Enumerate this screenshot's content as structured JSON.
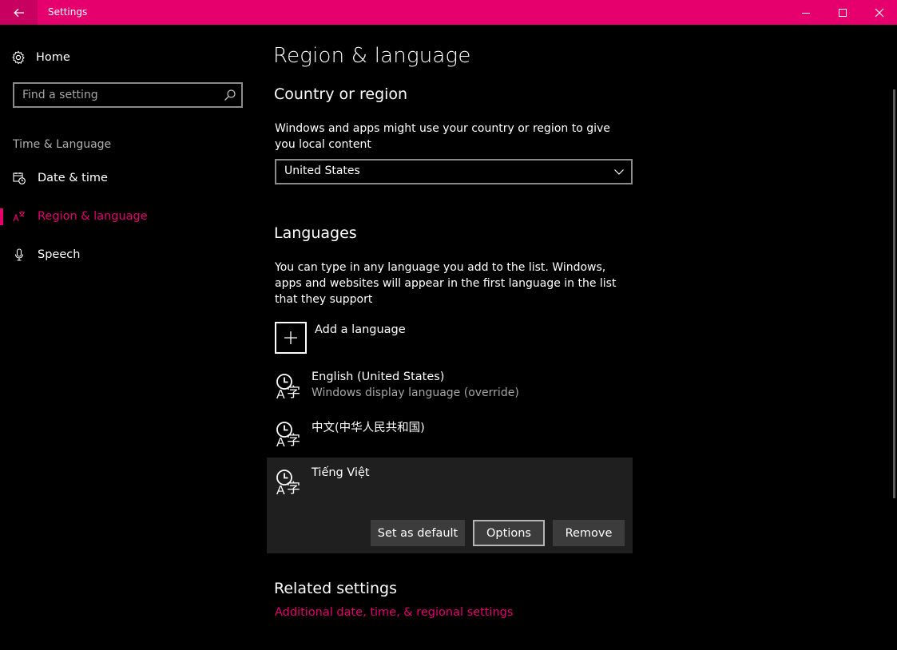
{
  "window": {
    "title": "Settings",
    "accent_color": "#e6006e",
    "buttons": [
      "back-icon",
      "minimize-icon",
      "maximize-icon",
      "close-icon"
    ]
  },
  "sidebar": {
    "home_label": "Home",
    "search_placeholder": "Find a setting",
    "group_label": "Time & Language",
    "items": [
      {
        "label": "Date & time",
        "icon": "date-time-icon",
        "selected": false
      },
      {
        "label": "Region & language",
        "icon": "region-language-icon",
        "selected": true
      },
      {
        "label": "Speech",
        "icon": "microphone-icon",
        "selected": false
      }
    ]
  },
  "main": {
    "title": "Region & language",
    "country": {
      "heading": "Country or region",
      "description": "Windows and apps might use your country or region to give you local content",
      "selected": "United States"
    },
    "languages": {
      "heading": "Languages",
      "description": "You can type in any language you add to the list. Windows, apps and websites will appear in the first language in the list that they support",
      "add_label": "Add a language",
      "items": [
        {
          "name": "English (United States)",
          "sub": "Windows display language (override)"
        },
        {
          "name": "中文(中华人民共和国)",
          "sub": ""
        },
        {
          "name": "Tiếng Việt",
          "sub": "",
          "selected": true
        }
      ],
      "actions": {
        "set_default": "Set as default",
        "options": "Options",
        "remove": "Remove"
      }
    },
    "related": {
      "heading": "Related settings",
      "link": "Additional date, time, & regional settings"
    }
  }
}
